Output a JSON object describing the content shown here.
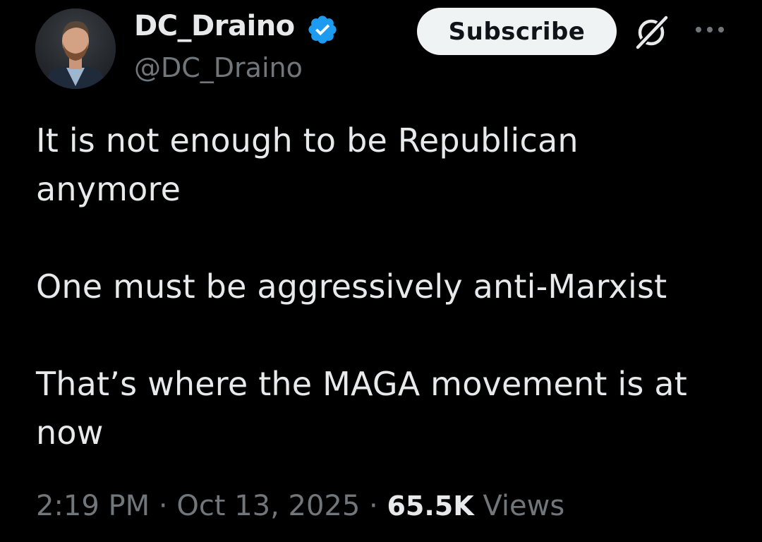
{
  "author": {
    "display_name": "DC_Draino",
    "handle": "@DC_Draino",
    "verified": true
  },
  "actions": {
    "subscribe_label": "Subscribe",
    "grok_icon": "grok-icon",
    "more_icon": "more-icon"
  },
  "tweet": {
    "paragraphs": [
      "It is not enough to be Republican anymore",
      "One must be aggressively anti-Marxist",
      "That’s where the MAGA movement is at now"
    ]
  },
  "meta": {
    "time": "2:19 PM",
    "separator": " · ",
    "date": "Oct 13, 2025",
    "views_count": "65.5K",
    "views_label": "Views"
  },
  "colors": {
    "background": "#000000",
    "primary_text": "#e7e9ea",
    "secondary_text": "#71767b",
    "verified_badge": "#1d9bf0",
    "subscribe_bg": "#eff3f4"
  }
}
